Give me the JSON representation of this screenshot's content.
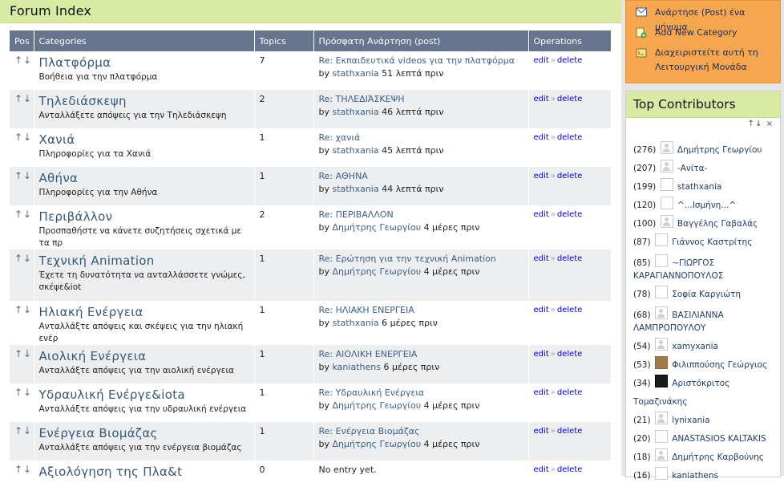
{
  "forum": {
    "title": "Forum Index",
    "columns": {
      "pos": "Pos",
      "categories": "Categories",
      "topics": "Topics",
      "last_post": "Πρόσφατη Ανάρτηση (post)",
      "operations": "Operations"
    },
    "arrows": "↑↓",
    "ops": {
      "edit": "edit",
      "sep": "»",
      "delete": "delete"
    },
    "by": "by",
    "rows": [
      {
        "name": "Πλατφόρμα",
        "desc": "Βοήθεια για την πλατφόρμα",
        "topics": "7",
        "post_title": "Re: Εκπαιδευτικά videos για την πλατφόρμα",
        "post_user": "stathxania",
        "post_time": "51 λεπτά πριν"
      },
      {
        "name": "Τηλεδιάσκεψη",
        "desc": "Ανταλλάξετε απόψεις για την Τηλεδιάσκεψη",
        "topics": "2",
        "post_title": "Re: ΤΗΛΕΔΙΆΣΚΕΨΗ",
        "post_user": "stathxania",
        "post_time": "46 λεπτά πριν"
      },
      {
        "name": "Χανιά",
        "desc": "Πληροφορίες για τα Χανιά",
        "topics": "1",
        "post_title": "Re: χανιά",
        "post_user": "stathxania",
        "post_time": "45 λεπτά πριν"
      },
      {
        "name": "Αθήνα",
        "desc": "Πληροφορίες για την Αθήνα",
        "topics": "1",
        "post_title": "Re: ΑΘΗΝΑ",
        "post_user": "stathxania",
        "post_time": "44 λεπτά πριν"
      },
      {
        "name": "Περιβάλλον",
        "desc": "Προσπαθήστε να κάνετε συζητήσεις σχετικά με τα πρ",
        "topics": "2",
        "post_title": "Re: ΠΕΡΙΒΑΛΛΟΝ",
        "post_user": "Δημήτρης Γεωργίου",
        "post_time": "4 μέρες πριν"
      },
      {
        "name": "Τεχνική Animation",
        "desc": "Έχετε τη δυνατότητα να ανταλλάσσετε γνώμες, σκέψε&iot",
        "topics": "1",
        "post_title": "Re: Ερώτηση για την τεχνική Animation",
        "post_user": "Δημήτρης Γεωργίου",
        "post_time": "4 μέρες πριν"
      },
      {
        "name": "Ηλιακή Ενέργεια",
        "desc": "Ανταλλάξτε απόψεις και σκέψεις για την ηλιακή ενέρ",
        "topics": "1",
        "post_title": "Re: ΗΛΙΑΚΗ ΕΝΕΡΓΕΙΑ",
        "post_user": "stathxania",
        "post_time": "6 μέρες πριν"
      },
      {
        "name": "Αιολική Ενέργεια",
        "desc": "Ανταλλάξτε απόψεις για την αιολική ενέργεια",
        "topics": "1",
        "post_title": "Re: ΑΙΟΛΙΚΗ ΕΝΕΡΓΕΙΑ",
        "post_user": "kaniathens",
        "post_time": "6 μέρες πριν"
      },
      {
        "name": "Υδραυλική Ενέργε&iota",
        "desc": "Ανταλλάξτε απόψεις για την υδραυλική ενέργεια",
        "topics": "1",
        "post_title": "Re: Υδραυλική Ενέργεια",
        "post_user": "Δημήτρης Γεωργίου",
        "post_time": "4 μέρες πριν"
      },
      {
        "name": "Ενέργεια Βιομάζας",
        "desc": "Ανταλλάξτε απόψεις για την ενέργεια βιομάζας",
        "topics": "1",
        "post_title": "Re: Ενέργεια Βιομάζας",
        "post_user": "Δημήτρης Γεωργίου",
        "post_time": "4 μέρες πριν"
      },
      {
        "name": "Αξιολόγηση της Πλα&t",
        "desc": "",
        "topics": "0",
        "no_entry": "No entry yet."
      }
    ]
  },
  "sidebar": {
    "actions": [
      {
        "icon": "envelope-icon",
        "label": "Ανάρτησε (Post) ένα μήνυμα"
      },
      {
        "icon": "add-category-icon",
        "label": "Add New Category"
      },
      {
        "icon": "manage-unit-icon",
        "label": "Διαχειριστείτε αυτή τη Λειτουργική Μονάδα"
      }
    ],
    "contributors": {
      "title": "Top Contributors",
      "tools": {
        "up": "↑",
        "down": "↓",
        "close": "×"
      },
      "items": [
        {
          "count": "(276)",
          "name": "Δημήτρης Γεωργίου",
          "avatar": "person"
        },
        {
          "count": "(207)",
          "name": "-Ανίτα-",
          "avatar": "person"
        },
        {
          "count": "(199)",
          "name": "stathxania",
          "avatar": "blank"
        },
        {
          "count": "(120)",
          "name": "^...Ισμήνη...^",
          "avatar": "blank"
        },
        {
          "count": "(100)",
          "name": "Βαγγέλης Γαβαλάς",
          "avatar": "person"
        },
        {
          "count": "(87)",
          "name": "Γιάννος Καστρίτης",
          "avatar": "blank"
        },
        {
          "count": "(85)",
          "name": "~ΓΙΩΡΓΟΣ ΚΑΡΑΓΙΑΝΝΟΠΟΥΛΟΣ",
          "avatar": "blank",
          "wrap": true
        },
        {
          "count": "(78)",
          "name": "Σοφία Καργιώτη",
          "avatar": "blank"
        },
        {
          "count": "(68)",
          "name": "ΒΑΣΙΛΙΑΝΝΑ ΛΑΜΠΡΟΠΟΥΛΟΥ",
          "avatar": "person",
          "wrap": true
        },
        {
          "count": "(54)",
          "name": "xamyxania",
          "avatar": "person"
        },
        {
          "count": "(53)",
          "name": "Φιλιππούσης Γεώργιος",
          "avatar": "photo1"
        },
        {
          "count": "(34)",
          "name": "Αριστόκριτος Τομαζινάκης",
          "avatar": "photo2"
        },
        {
          "count": "(21)",
          "name": "lynixania",
          "avatar": "person"
        },
        {
          "count": "(20)",
          "name": "ANASTASIOS KALTAKIS",
          "avatar": "blank"
        },
        {
          "count": "(18)",
          "name": "Δημήτρης Καρβούνης",
          "avatar": "person"
        },
        {
          "count": "(16)",
          "name": "kaniathens",
          "avatar": "blank"
        }
      ]
    }
  }
}
